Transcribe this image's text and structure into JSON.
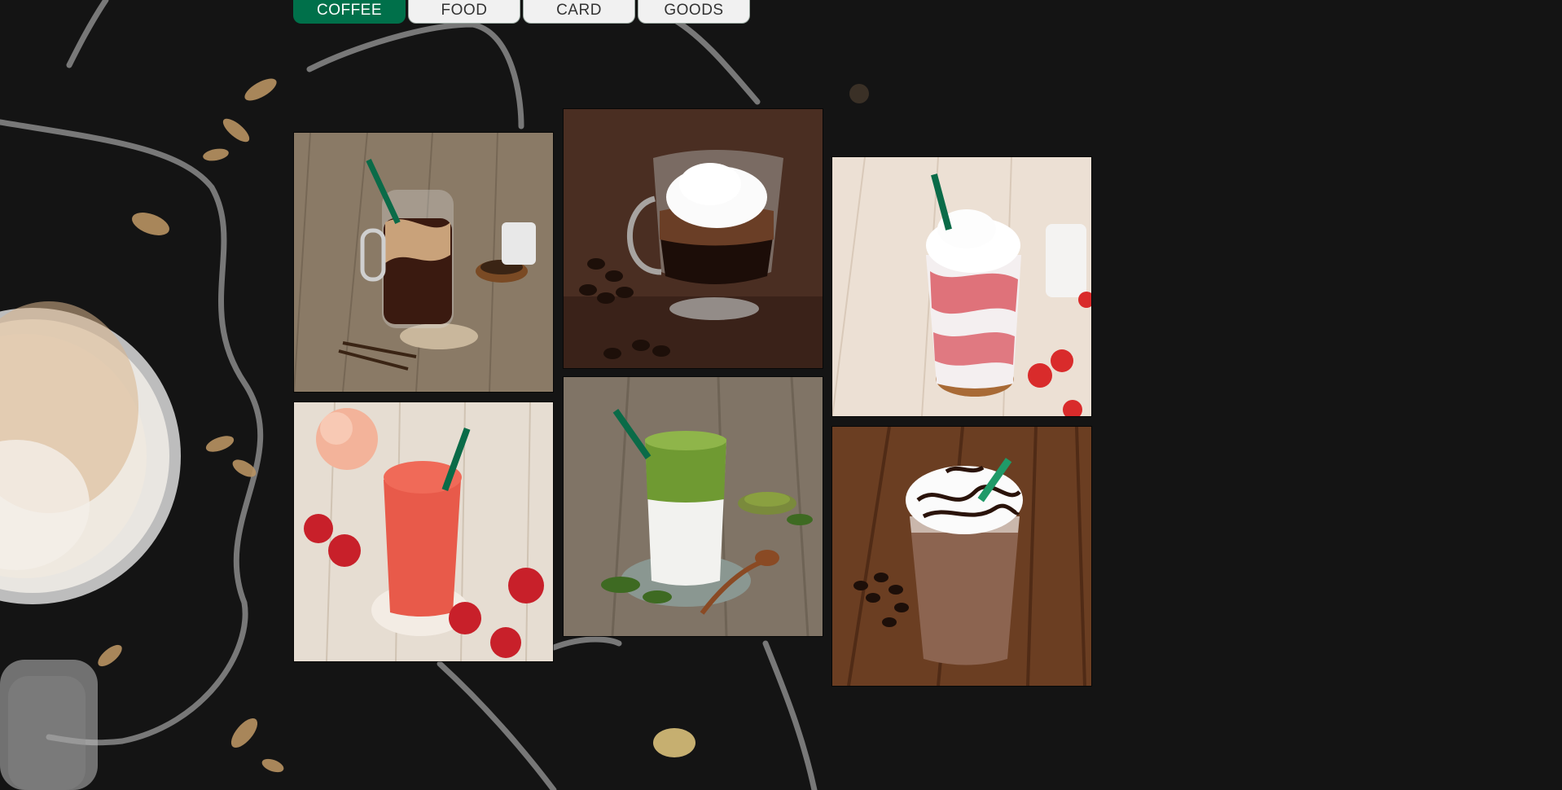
{
  "nav": {
    "tabs": [
      {
        "label": "COFFEE",
        "active": true
      },
      {
        "label": "FOOD",
        "active": false
      },
      {
        "label": "CARD",
        "active": false
      },
      {
        "label": "GOODS",
        "active": false
      }
    ]
  },
  "colors": {
    "brand_green": "#00704a",
    "chalkboard": "#141414",
    "tab_inactive": "#f1f1f1"
  },
  "gallery": {
    "items": [
      {
        "icon": "iced-coffee-jar-photo"
      },
      {
        "icon": "affogato-cream-glass-photo"
      },
      {
        "icon": "strawberry-frappuccino-photo"
      },
      {
        "icon": "peach-strawberry-smoothie-photo"
      },
      {
        "icon": "matcha-latte-photo"
      },
      {
        "icon": "chocolate-frappuccino-photo"
      }
    ]
  }
}
